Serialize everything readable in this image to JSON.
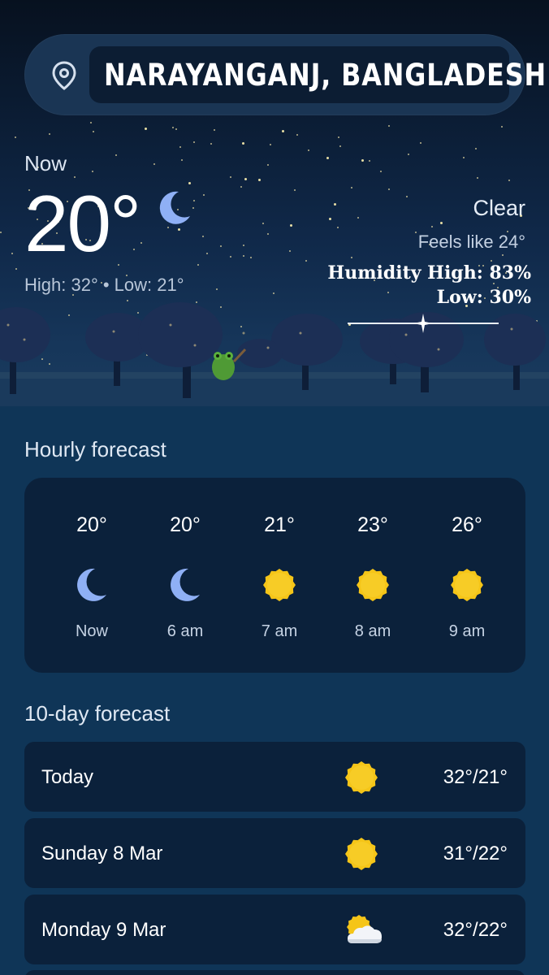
{
  "location": {
    "name": "NARAYANGANJ, BANGLADESH",
    "icon": "location-pin-icon"
  },
  "current": {
    "label": "Now",
    "temperature": "20°",
    "condition_icon": "moon-icon",
    "high_low": "High: 32° • Low: 21°",
    "condition": "Clear",
    "feels_like": "Feels like 24°",
    "humidity_high": "Humidity High: 83%",
    "humidity_low": "Low: 30%"
  },
  "hourly": {
    "title": "Hourly forecast",
    "items": [
      {
        "temp": "20°",
        "icon": "moon-icon",
        "label": "Now"
      },
      {
        "temp": "20°",
        "icon": "moon-icon",
        "label": "6 am"
      },
      {
        "temp": "21°",
        "icon": "sun-icon",
        "label": "7 am"
      },
      {
        "temp": "23°",
        "icon": "sun-icon",
        "label": "8 am"
      },
      {
        "temp": "26°",
        "icon": "sun-icon",
        "label": "9 am"
      }
    ]
  },
  "daily": {
    "title": "10-day forecast",
    "items": [
      {
        "day": "Today",
        "icon": "sun-icon",
        "temps": "32°/21°"
      },
      {
        "day": "Sunday 8 Mar",
        "icon": "sun-icon",
        "temps": "31°/22°"
      },
      {
        "day": "Monday 9 Mar",
        "icon": "partly-cloudy-icon",
        "temps": "32°/22°"
      }
    ]
  },
  "colors": {
    "background": "#0f3557",
    "card": "#0b213b",
    "sun": "#f5c518",
    "moon": "#8fb0f5"
  }
}
